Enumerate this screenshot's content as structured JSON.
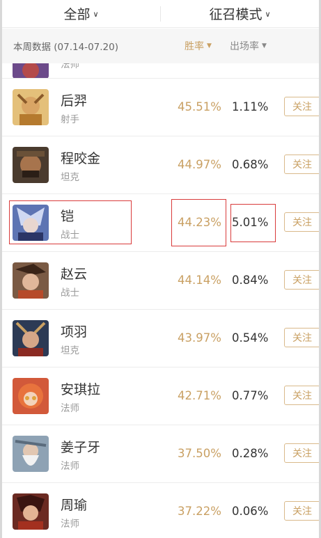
{
  "header": {
    "filter_left": "全部",
    "filter_right": "征召模式",
    "week_label": "本周数据 (07.14-07.20)",
    "sort_win_label": "胜率",
    "sort_pick_label": "出场率"
  },
  "colors": {
    "accent": "#c9a063",
    "highlight": "#d93a3a"
  },
  "partial_row": {
    "role": "法师"
  },
  "heroes": [
    {
      "name": "后羿",
      "role": "射手",
      "win_rate": "45.51%",
      "pick_rate": "1.11%",
      "follow_label": "关注",
      "avatar_icon": "houyi-avatar"
    },
    {
      "name": "程咬金",
      "role": "坦克",
      "win_rate": "44.97%",
      "pick_rate": "0.68%",
      "follow_label": "关注",
      "avatar_icon": "chengyaojin-avatar"
    },
    {
      "name": "铠",
      "role": "战士",
      "win_rate": "44.23%",
      "pick_rate": "5.01%",
      "follow_label": "关注",
      "avatar_icon": "kai-avatar"
    },
    {
      "name": "赵云",
      "role": "战士",
      "win_rate": "44.14%",
      "pick_rate": "0.84%",
      "follow_label": "关注",
      "avatar_icon": "zhaoyun-avatar"
    },
    {
      "name": "项羽",
      "role": "坦克",
      "win_rate": "43.97%",
      "pick_rate": "0.54%",
      "follow_label": "关注",
      "avatar_icon": "xiangyu-avatar"
    },
    {
      "name": "安琪拉",
      "role": "法师",
      "win_rate": "42.71%",
      "pick_rate": "0.77%",
      "follow_label": "关注",
      "avatar_icon": "anqila-avatar"
    },
    {
      "name": "姜子牙",
      "role": "法师",
      "win_rate": "37.50%",
      "pick_rate": "0.28%",
      "follow_label": "关注",
      "avatar_icon": "jiangziya-avatar"
    },
    {
      "name": "周瑜",
      "role": "法师",
      "win_rate": "37.22%",
      "pick_rate": "0.06%",
      "follow_label": "关注",
      "avatar_icon": "zhouyu-avatar"
    }
  ]
}
